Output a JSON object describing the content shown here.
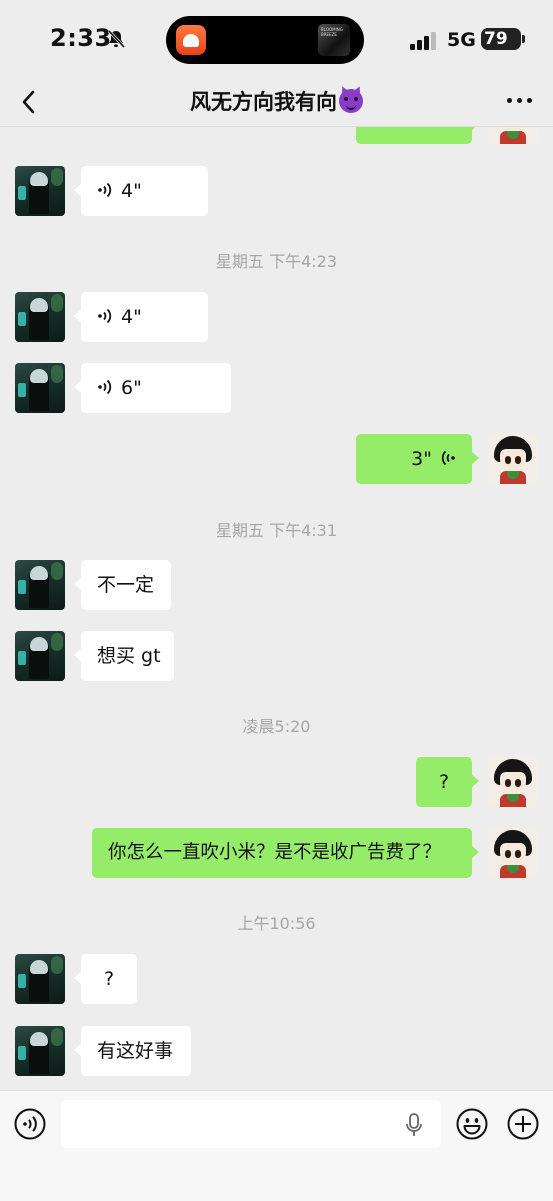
{
  "status_bar": {
    "time": "2:33",
    "network": "5G",
    "battery": "79",
    "island_art_text": "BLOOMING\nBREEZE"
  },
  "nav": {
    "title": "风无方向我有向"
  },
  "messages": [
    {
      "type": "voice",
      "from": "friend",
      "text": "4\""
    },
    {
      "type": "time",
      "text": "星期五 下午4:23"
    },
    {
      "type": "voice",
      "from": "friend",
      "text": "4\""
    },
    {
      "type": "voice",
      "from": "friend",
      "text": "6\""
    },
    {
      "type": "voice",
      "from": "me",
      "text": "3\""
    },
    {
      "type": "time",
      "text": "星期五 下午4:31"
    },
    {
      "type": "text",
      "from": "friend",
      "text": "不一定"
    },
    {
      "type": "text",
      "from": "friend",
      "text": "想买 gt"
    },
    {
      "type": "time",
      "text": "凌晨5:20"
    },
    {
      "type": "text",
      "from": "me",
      "text": "?"
    },
    {
      "type": "text",
      "from": "me",
      "text": "你怎么一直吹小米？是不是收广告费了？"
    },
    {
      "type": "time",
      "text": "上午10:56"
    },
    {
      "type": "text",
      "from": "friend",
      "text": "?"
    },
    {
      "type": "text",
      "from": "friend",
      "text": "有这好事"
    }
  ],
  "input": {
    "value": "",
    "placeholder": ""
  },
  "colors": {
    "background": "#ededed",
    "outgoing_bubble": "#95ec69",
    "incoming_bubble": "#ffffff",
    "timestamp": "#a6a6a6"
  },
  "icons": [
    "bell-slash-icon",
    "signal-icon",
    "battery-icon",
    "back-chevron-icon",
    "more-dots-icon",
    "voice-wave-icon",
    "voice-mode-icon",
    "microphone-icon",
    "emoji-icon",
    "plus-icon"
  ]
}
